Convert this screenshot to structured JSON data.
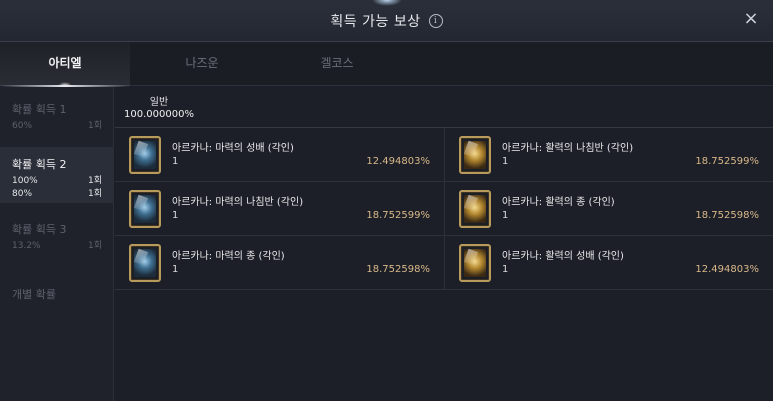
{
  "header": {
    "title": "획득 가능 보상",
    "info_icon": "i",
    "close_icon": "×"
  },
  "tabs": [
    {
      "label": "아티엘",
      "active": true
    },
    {
      "label": "나즈운",
      "active": false
    },
    {
      "label": "겔코스",
      "active": false
    }
  ],
  "sidebar": {
    "items": [
      {
        "label": "확률 획득 1",
        "rows": [
          {
            "left": "60%",
            "right": "1회"
          }
        ]
      },
      {
        "label": "확률 획득 2",
        "rows": [
          {
            "left": "100%",
            "right": "1회"
          },
          {
            "left": "80%",
            "right": "1회"
          }
        ]
      },
      {
        "label": "확률 획득 3",
        "rows": [
          {
            "left": "13.2%",
            "right": "1회"
          }
        ]
      },
      {
        "label": "개별 확률",
        "rows": []
      }
    ]
  },
  "grade": {
    "name": "일반",
    "rate": "100.000000%"
  },
  "items": [
    {
      "name": "아르카나: 마력의 성배 (각인)",
      "qty": "1",
      "rate": "12.494803%",
      "icon": "blue"
    },
    {
      "name": "아르카나: 활력의 나침반 (각인)",
      "qty": "1",
      "rate": "18.752599%",
      "icon": "gold"
    },
    {
      "name": "아르카나: 마력의 나침반 (각인)",
      "qty": "1",
      "rate": "18.752599%",
      "icon": "blue"
    },
    {
      "name": "아르카나: 활력의 종 (각인)",
      "qty": "1",
      "rate": "18.752598%",
      "icon": "gold"
    },
    {
      "name": "아르카나: 마력의 종 (각인)",
      "qty": "1",
      "rate": "18.752598%",
      "icon": "blue"
    },
    {
      "name": "아르카나: 활력의 성배 (각인)",
      "qty": "1",
      "rate": "12.494803%",
      "icon": "gold"
    }
  ]
}
